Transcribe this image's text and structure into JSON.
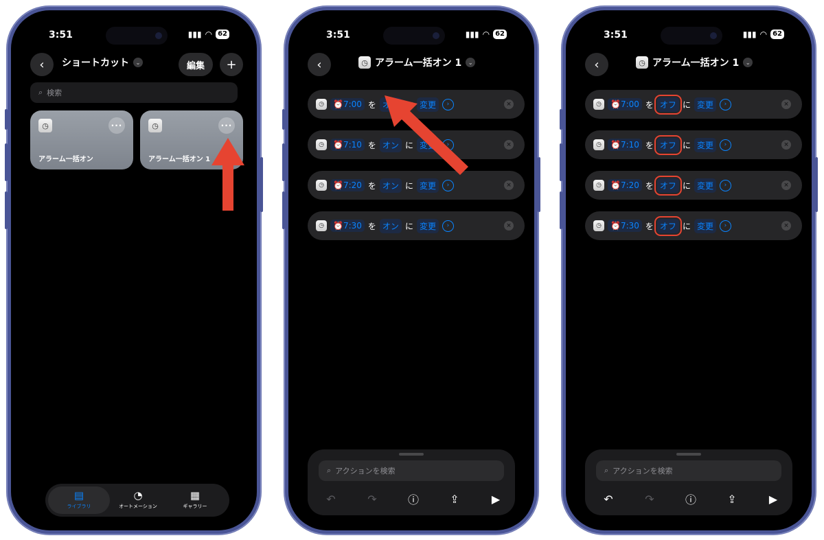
{
  "status": {
    "time": "3:51",
    "battery": "62"
  },
  "phone1": {
    "title": "ショートカット",
    "edit_label": "編集",
    "add_label": "+",
    "search_placeholder": "検索",
    "cards": [
      {
        "name": "アラーム一括オン"
      },
      {
        "name": "アラーム一括オン 1"
      }
    ],
    "tabs": [
      {
        "label": "ライブラリ",
        "icon": "library-icon",
        "active": true
      },
      {
        "label": "オートメーション",
        "icon": "automation-clock-icon",
        "active": false
      },
      {
        "label": "ギャラリー",
        "icon": "gallery-grid-icon",
        "active": false
      }
    ]
  },
  "phone2": {
    "title": "アラーム一括オン 1",
    "connector_wo": "を",
    "connector_ni": "に",
    "change_label": "変更",
    "actions": [
      {
        "time": "7:00",
        "state": "オン"
      },
      {
        "time": "7:10",
        "state": "オン"
      },
      {
        "time": "7:20",
        "state": "オン"
      },
      {
        "time": "7:30",
        "state": "オン"
      }
    ],
    "search_placeholder": "アクションを検索"
  },
  "phone3": {
    "title": "アラーム一括オン 1",
    "connector_wo": "を",
    "connector_ni": "に",
    "change_label": "変更",
    "actions": [
      {
        "time": "7:00",
        "state": "オフ"
      },
      {
        "time": "7:10",
        "state": "オフ"
      },
      {
        "time": "7:20",
        "state": "オフ"
      },
      {
        "time": "7:30",
        "state": "オフ"
      }
    ],
    "search_placeholder": "アクションを検索"
  },
  "colors": {
    "accent": "#0a84ff",
    "highlight": "#e64431",
    "bezel": "#4a5596"
  }
}
